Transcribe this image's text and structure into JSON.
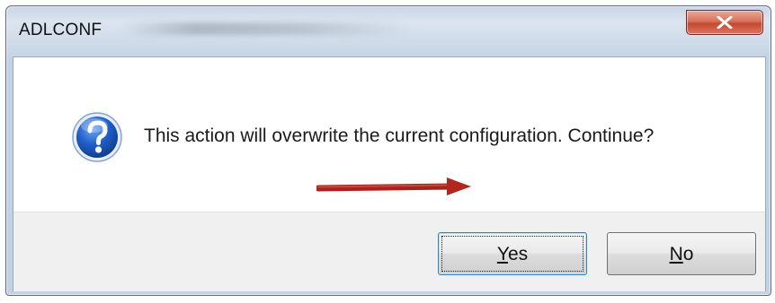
{
  "window": {
    "title": "ADLCONF",
    "close_icon": "close-x-icon"
  },
  "message": {
    "icon": "question-icon",
    "text": "This action will overwrite the current configuration. Continue?"
  },
  "buttons": {
    "yes": {
      "mnemonic": "Y",
      "rest": "es"
    },
    "no": {
      "mnemonic": "N",
      "rest": "o"
    }
  },
  "annotation": {
    "arrow_color": "#c0392b",
    "target": "yes-button"
  }
}
